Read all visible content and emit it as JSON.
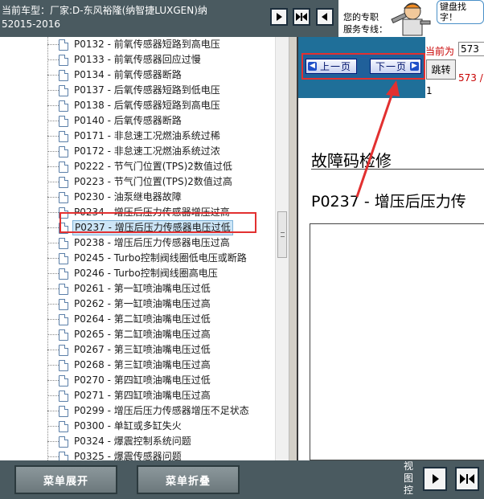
{
  "header": {
    "car_line1": "当前车型：厂家:D-东风裕隆(纳智捷LUXGEN)纳",
    "car_line2": "52015-2016",
    "service_line1": "您的专职",
    "service_line2": "服务专线：",
    "bubble_line1": "键盘找",
    "bubble_line2": "字！"
  },
  "tree": {
    "items": [
      {
        "label": "P0132 - 前氧传感器短路到高电压"
      },
      {
        "label": "P0133 - 前氧传感器回应过慢"
      },
      {
        "label": "P0134 - 前氧传感器断路"
      },
      {
        "label": "P0137 - 后氧传感器短路到低电压"
      },
      {
        "label": "P0138 - 后氧传感器短路到高电压"
      },
      {
        "label": "P0140 - 后氧传感器断路"
      },
      {
        "label": "P0171 - 非怠速工况燃油系统过稀"
      },
      {
        "label": "P0172 - 非怠速工况燃油系统过浓"
      },
      {
        "label": "P0222 - 节气门位置(TPS)2数值过低"
      },
      {
        "label": "P0223 - 节气门位置(TPS)2数值过高"
      },
      {
        "label": "P0230 - 油泵继电器故障"
      },
      {
        "label": "P0234 - 增压后压力传感器增压过高"
      },
      {
        "label": "P0237 - 增压后压力传感器电压过低"
      },
      {
        "label": "P0238 - 增压后压力传感器电压过高"
      },
      {
        "label": "P0245 - Turbo控制阀线圈低电压或断路"
      },
      {
        "label": "P0246 - Turbo控制阀线圈高电压"
      },
      {
        "label": "P0261 - 第一缸喷油嘴电压过低"
      },
      {
        "label": "P0262 - 第一缸喷油嘴电压过高"
      },
      {
        "label": "P0264 - 第二缸喷油嘴电压过低"
      },
      {
        "label": "P0265 - 第二缸喷油嘴电压过高"
      },
      {
        "label": "P0267 - 第三缸喷油嘴电压过低"
      },
      {
        "label": "P0268 - 第三缸喷油嘴电压过高"
      },
      {
        "label": "P0270 - 第四缸喷油嘴电压过低"
      },
      {
        "label": "P0271 - 第四缸喷油嘴电压过高"
      },
      {
        "label": "P0299 - 增压后压力传感器增压不足状态"
      },
      {
        "label": "P0300 - 单缸或多缸失火"
      },
      {
        "label": "P0324 - 爆震控制系统问题"
      },
      {
        "label": "P0325 - 爆震传感器问题"
      }
    ],
    "selected_index": 12
  },
  "pager": {
    "prev_label": "上一页",
    "next_label": "下一页",
    "current_label": "当前为",
    "current_value": "573",
    "jump_label": "跳转",
    "total_text": "573 /",
    "page_one": "1"
  },
  "content": {
    "section_title": "故障码检修",
    "code_title": "P0237 - 增压后压力传"
  },
  "footer": {
    "expand_label": "菜单展开",
    "collapse_label": "菜单折叠",
    "view_label": "视图控"
  }
}
